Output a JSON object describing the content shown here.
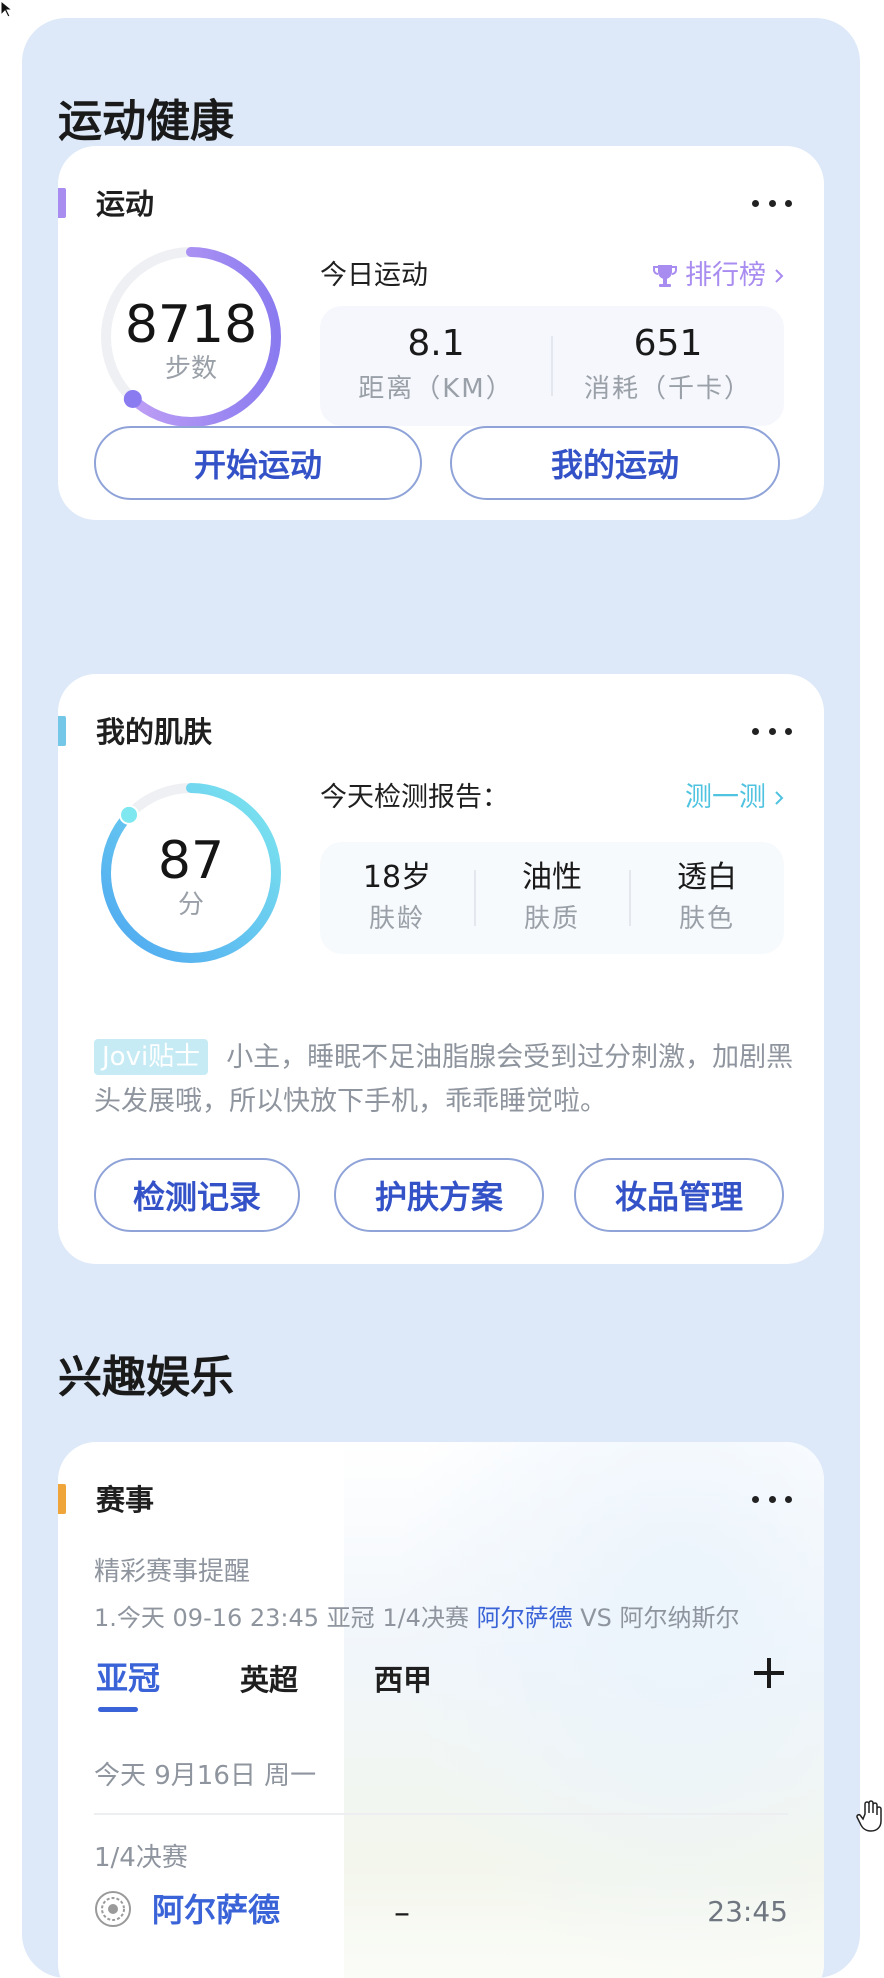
{
  "sections": {
    "health_title": "运动健康",
    "fun_title": "兴趣娱乐"
  },
  "sport": {
    "title": "运动",
    "steps": "8718",
    "steps_unit": "步数",
    "steps_progress": 0.62,
    "today_label": "今日运动",
    "rank_label": "排行榜",
    "distance_value": "8.1",
    "distance_label": "距离（KM）",
    "calorie_value": "651",
    "calorie_label": "消耗（千卡）",
    "btn_start": "开始运动",
    "btn_mine": "我的运动",
    "accent": "#a98cf0"
  },
  "skin": {
    "title": "我的肌肤",
    "score": "87",
    "score_unit": "分",
    "score_progress": 0.87,
    "report_label": "今天检测报告：",
    "test_label": "测一测",
    "stats": [
      {
        "value": "18岁",
        "label": "肤龄"
      },
      {
        "value": "油性",
        "label": "肤质"
      },
      {
        "value": "透白",
        "label": "肤色"
      }
    ],
    "tip_tag": "Jovi贴士",
    "tip_text": "小主，睡眠不足油脂腺会受到过分刺激，加剧黑头发展哦，所以快放下手机，乖乖睡觉啦。",
    "btn_record": "检测记录",
    "btn_plan": "护肤方案",
    "btn_makeup": "妆品管理",
    "accent": "#5ec5e8"
  },
  "match": {
    "title": "赛事",
    "reminder_title": "精彩赛事提醒",
    "reminder_prefix": "1.今天 09-16 23:45 亚冠 1/4决赛 ",
    "reminder_team_a": "阿尔萨德",
    "reminder_vs": " VS 阿尔纳斯尔",
    "tabs": [
      "亚冠",
      "英超",
      "西甲"
    ],
    "date_line": "今天 9月16日 周一",
    "round": "1/4决赛",
    "team": "阿尔萨德",
    "score": "–",
    "time": "23:45",
    "accent": "#f0a53a"
  }
}
